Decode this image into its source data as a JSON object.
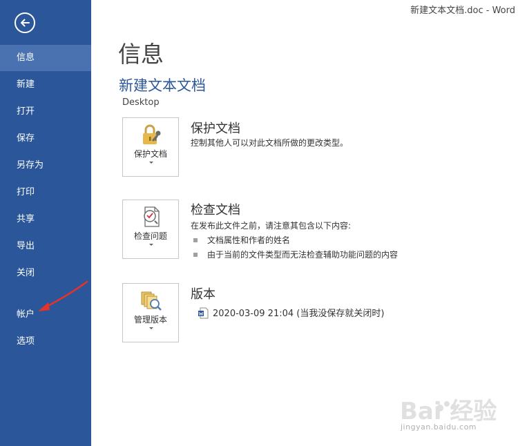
{
  "window": {
    "title": "新建文本文档.doc - Word"
  },
  "sidebar": {
    "back_icon": "back-arrow-icon",
    "items": [
      {
        "label": "信息",
        "active": true
      },
      {
        "label": "新建"
      },
      {
        "label": "打开"
      },
      {
        "label": "保存"
      },
      {
        "label": "另存为"
      },
      {
        "label": "打印"
      },
      {
        "label": "共享"
      },
      {
        "label": "导出"
      },
      {
        "label": "关闭"
      },
      {
        "label": "帐户"
      },
      {
        "label": "选项"
      }
    ],
    "colors": {
      "background": "#2b579a",
      "active": "#4a72b0"
    }
  },
  "main": {
    "title": "信息",
    "doc_name": "新建文本文档",
    "doc_path": "Desktop",
    "sections": [
      {
        "tile_label": "保护文档",
        "tile_icon": "lock-key-icon",
        "heading": "保护文档",
        "description": "控制其他人可以对此文档所做的更改类型。"
      },
      {
        "tile_label": "检查问题",
        "tile_icon": "inspect-document-icon",
        "heading": "检查文档",
        "description": "在发布此文件之前，请注意其包含以下内容:",
        "bullets": [
          "文档属性和作者的姓名",
          "由于当前的文件类型而无法检查辅助功能问题的内容"
        ]
      },
      {
        "tile_label": "管理版本",
        "tile_icon": "manage-versions-icon",
        "heading": "版本",
        "version_entry": "2020-03-09 21:04 (当我没保存就关闭时)",
        "version_icon": "word-document-icon"
      }
    ]
  },
  "annotation": {
    "type": "red-arrow",
    "color": "#e8312a"
  },
  "watermark": {
    "text": "Bai 经验",
    "subtext": "jingyan.baidu.com"
  }
}
